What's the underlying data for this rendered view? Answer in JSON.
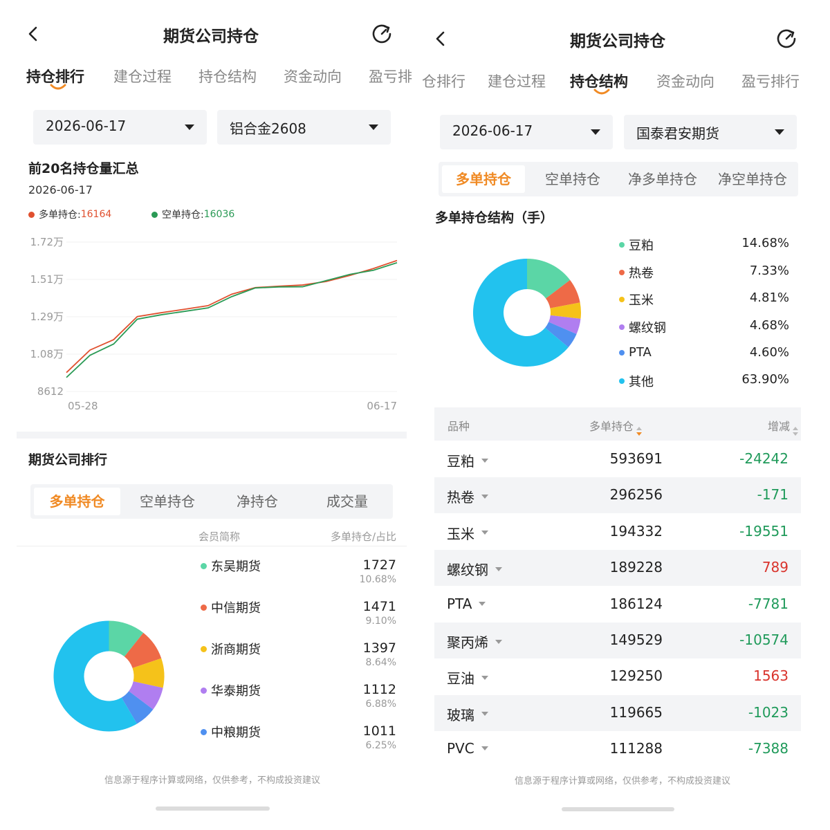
{
  "colors": {
    "accent": "#f08a24",
    "long": "#e0502f",
    "short": "#2a9a55",
    "up": "#d9332c",
    "down": "#1f9a5a",
    "pie": [
      "#5bd6a6",
      "#ee6a47",
      "#f5c21a",
      "#b07ef0",
      "#4f90f0",
      "#22c2ee"
    ]
  },
  "left": {
    "header": {
      "title": "期货公司持仓"
    },
    "tabs": [
      "持仓排行",
      "建仓过程",
      "持仓结构",
      "资金动向",
      "盈亏排"
    ],
    "active_tab": 0,
    "date_select": "2026-06-17",
    "contract_select": "铝合金2608",
    "summary": {
      "title": "前20名持仓量汇总",
      "date": "2026-06-17",
      "long_label": "多单持仓: ",
      "long_value": "16164",
      "short_label": "空单持仓: ",
      "short_value": "16036"
    },
    "chart_data": {
      "type": "line",
      "x_ticks": [
        "05-28",
        "06-17"
      ],
      "y_ticks": [
        "1.72万",
        "1.51万",
        "1.29万",
        "1.08万",
        "8612"
      ],
      "ylim": [
        8612,
        17224
      ],
      "x": [
        "05-28",
        "05-29",
        "06-01",
        "06-02",
        "06-03",
        "06-04",
        "06-05",
        "06-08",
        "06-09",
        "06-10",
        "06-11",
        "06-12",
        "06-15",
        "06-16",
        "06-17"
      ],
      "series": [
        {
          "name": "多单持仓",
          "values": [
            9700,
            11000,
            11600,
            12930,
            13150,
            13350,
            13560,
            14220,
            14600,
            14680,
            14750,
            14950,
            15300,
            15700,
            16164
          ]
        },
        {
          "name": "空单持仓",
          "values": [
            9420,
            10700,
            11350,
            12780,
            13030,
            13230,
            13430,
            14080,
            14580,
            14640,
            14650,
            15000,
            15360,
            15600,
            16036
          ]
        }
      ]
    },
    "ranking": {
      "title": "期货公司排行",
      "segments": [
        "多单持仓",
        "空单持仓",
        "净持仓",
        "成交量"
      ],
      "active_segment": 0,
      "col_member": "会员简称",
      "col_value": "多单持仓/占比",
      "items": [
        {
          "name": "东吴期货",
          "value": "1727",
          "pct": "10.68%"
        },
        {
          "name": "中信期货",
          "value": "1471",
          "pct": "9.10%"
        },
        {
          "name": "浙商期货",
          "value": "1397",
          "pct": "8.64%"
        },
        {
          "name": "华泰期货",
          "value": "1112",
          "pct": "6.88%"
        },
        {
          "name": "中粮期货",
          "value": "1011",
          "pct": "6.25%"
        }
      ],
      "pie_data": {
        "type": "pie",
        "values": [
          10.68,
          9.1,
          8.64,
          6.88,
          6.25,
          58.45
        ]
      }
    },
    "footer": "信息源于程序计算或网络，仅供参考，不构成投资建议"
  },
  "right": {
    "header": {
      "title": "期货公司持仓"
    },
    "tabs": [
      "仓排行",
      "建仓过程",
      "持仓结构",
      "资金动向",
      "盈亏排行"
    ],
    "active_tab": 2,
    "date_select": "2026-06-17",
    "company_select": "国泰君安期货",
    "segments": [
      "多单持仓",
      "空单持仓",
      "净多单持仓",
      "净空单持仓"
    ],
    "active_segment": 0,
    "structure_title": "多单持仓结构（手）",
    "chart_data": {
      "type": "pie",
      "categories": [
        "豆粕",
        "热卷",
        "玉米",
        "螺纹钢",
        "PTA",
        "其他"
      ],
      "values": [
        14.68,
        7.33,
        4.81,
        4.68,
        4.6,
        63.9
      ],
      "labels": [
        "14.68%",
        "7.33%",
        "4.81%",
        "4.68%",
        "4.60%",
        "63.90%"
      ]
    },
    "table": {
      "col_variety": "品种",
      "col_long": "多单持仓",
      "col_change": "增减",
      "rows": [
        {
          "name": "豆粕",
          "long": "593691",
          "change": "-24242",
          "dir": "down"
        },
        {
          "name": "热卷",
          "long": "296256",
          "change": "-171",
          "dir": "down"
        },
        {
          "name": "玉米",
          "long": "194332",
          "change": "-19551",
          "dir": "down"
        },
        {
          "name": "螺纹钢",
          "long": "189228",
          "change": "789",
          "dir": "up"
        },
        {
          "name": "PTA",
          "long": "186124",
          "change": "-7781",
          "dir": "down"
        },
        {
          "name": "聚丙烯",
          "long": "149529",
          "change": "-10574",
          "dir": "down"
        },
        {
          "name": "豆油",
          "long": "129250",
          "change": "1563",
          "dir": "up"
        },
        {
          "name": "玻璃",
          "long": "119665",
          "change": "-1023",
          "dir": "down"
        },
        {
          "name": "PVC",
          "long": "111288",
          "change": "-7388",
          "dir": "down"
        }
      ]
    },
    "footer": "信息源于程序计算或网络，仅供参考，不构成投资建议"
  }
}
